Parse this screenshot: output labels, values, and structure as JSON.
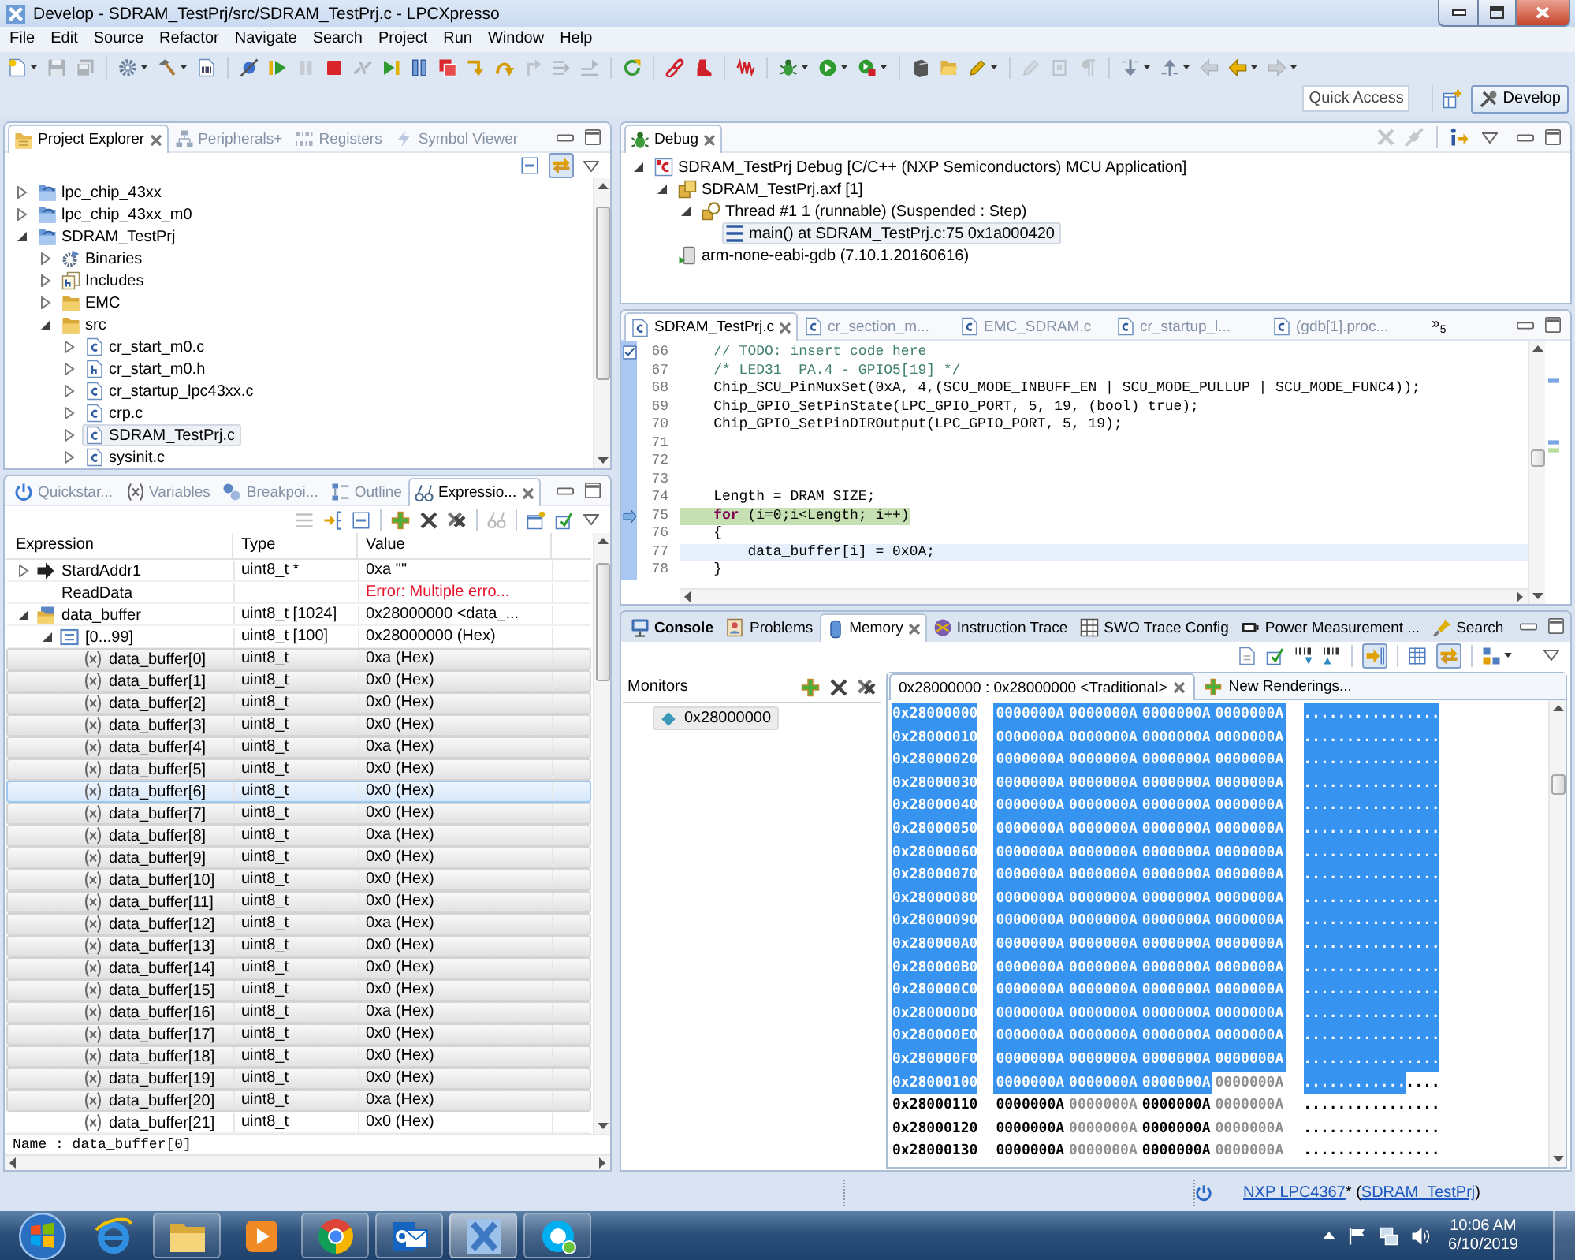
{
  "window": {
    "title": "Develop - SDRAM_TestPrj/src/SDRAM_TestPrj.c - LPCXpresso"
  },
  "menu": [
    "File",
    "Edit",
    "Source",
    "Refactor",
    "Navigate",
    "Search",
    "Project",
    "Run",
    "Window",
    "Help"
  ],
  "toolbar": [
    [
      {
        "disabled": false,
        "dropdown": true
      },
      {
        "disabled": true,
        "dropdown": false
      },
      {
        "disabled": true,
        "dropdown": false
      }
    ],
    [
      {
        "disabled": false,
        "dropdown": true
      },
      {
        "disabled": false,
        "dropdown": true
      },
      {
        "disabled": false,
        "dropdown": false
      }
    ],
    [
      {
        "disabled": false,
        "dropdown": false
      },
      {
        "disabled": false,
        "dropdown": false
      },
      {
        "disabled": true,
        "dropdown": false
      },
      {
        "disabled": false,
        "dropdown": false
      },
      {
        "disabled": true,
        "dropdown": false
      },
      {
        "disabled": false,
        "dropdown": false
      },
      {
        "disabled": false,
        "dropdown": false
      },
      {
        "disabled": false,
        "dropdown": false
      },
      {
        "disabled": false,
        "dropdown": false
      },
      {
        "disabled": false,
        "dropdown": false
      },
      {
        "disabled": true,
        "dropdown": false
      },
      {
        "disabled": true,
        "dropdown": false
      },
      {
        "disabled": true,
        "dropdown": false
      }
    ],
    [
      {
        "disabled": false,
        "dropdown": false
      }
    ],
    [
      {
        "disabled": false,
        "dropdown": false
      },
      {
        "disabled": false,
        "dropdown": false
      }
    ],
    [
      {
        "disabled": false,
        "dropdown": false
      }
    ],
    [
      {
        "disabled": false,
        "dropdown": true
      },
      {
        "disabled": false,
        "dropdown": true
      },
      {
        "disabled": false,
        "dropdown": true
      }
    ],
    [
      {
        "disabled": false,
        "dropdown": false
      },
      {
        "disabled": false,
        "dropdown": false
      },
      {
        "disabled": false,
        "dropdown": true
      }
    ],
    [
      {
        "disabled": true,
        "dropdown": false
      },
      {
        "disabled": true,
        "dropdown": false
      },
      {
        "disabled": true,
        "dropdown": false
      }
    ],
    [
      {
        "disabled": false,
        "dropdown": true
      },
      {
        "disabled": false,
        "dropdown": true
      },
      {
        "disabled": true,
        "dropdown": false
      },
      {
        "disabled": false,
        "dropdown": true
      },
      {
        "disabled": true,
        "dropdown": true
      }
    ]
  ],
  "quick_access": {
    "placeholder": "Quick Access"
  },
  "perspectives": [
    {
      "label": "Develop",
      "selected": true
    }
  ],
  "project_explorer": {
    "active": false,
    "tabs": [
      {
        "label": "Project Explorer",
        "selected": true
      },
      {
        "label": "Peripherals+",
        "selected": false
      },
      {
        "label": "Registers",
        "selected": false
      },
      {
        "label": "Symbol Viewer",
        "selected": false
      }
    ],
    "toolbar": [
      [
        {
          "pressed": false
        },
        {
          "pressed": true
        }
      ]
    ],
    "tree": [
      {
        "label": "lpc_chip_43xx",
        "kind": "project",
        "expanded": false,
        "selected": false
      },
      {
        "label": "lpc_chip_43xx_m0",
        "kind": "project",
        "expanded": false,
        "selected": false
      },
      {
        "label": "SDRAM_TestPrj",
        "kind": "project",
        "expanded": true,
        "selected": false,
        "children": [
          {
            "label": "Binaries",
            "kind": "binaries",
            "expanded": false,
            "selected": false
          },
          {
            "label": "Includes",
            "kind": "includes",
            "expanded": false,
            "selected": false
          },
          {
            "label": "EMC",
            "kind": "folder",
            "expanded": false,
            "selected": false
          },
          {
            "label": "src",
            "kind": "folder",
            "expanded": true,
            "selected": false,
            "children": [
              {
                "label": "cr_start_m0.c",
                "kind": "c-file",
                "expanded": false,
                "selected": false
              },
              {
                "label": "cr_start_m0.h",
                "kind": "h-file",
                "expanded": false,
                "selected": false
              },
              {
                "label": "cr_startup_lpc43xx.c",
                "kind": "c-file",
                "expanded": false,
                "selected": false
              },
              {
                "label": "crp.c",
                "kind": "c-file",
                "expanded": false,
                "selected": false
              },
              {
                "label": "SDRAM_TestPrj.c",
                "kind": "c-file",
                "expanded": false,
                "selected": true
              },
              {
                "label": "sysinit.c",
                "kind": "c-file",
                "expanded": false,
                "selected": false
              }
            ]
          }
        ]
      }
    ]
  },
  "debug": {
    "active": false,
    "tabs": [
      {
        "label": "Debug",
        "selected": true
      }
    ],
    "toolbar": [
      [
        {
          "disabled": true
        },
        {
          "disabled": true
        }
      ],
      [
        {
          "disabled": false
        }
      ]
    ],
    "tree": [
      {
        "label": "SDRAM_TestPrj Debug [C/C++ (NXP Semiconductors) MCU Application]",
        "kind": "launch",
        "expanded": true,
        "selected": false,
        "children": [
          {
            "label": "SDRAM_TestPrj.axf [1]",
            "kind": "process",
            "expanded": true,
            "selected": false,
            "children": [
              {
                "label": "Thread #1 1 (runnable) (Suspended : Step)",
                "kind": "thread",
                "expanded": true,
                "selected": false,
                "children": [
                  {
                    "label": "main() at SDRAM_TestPrj.c:75 0x1a000420",
                    "kind": "frame",
                    "selected": true
                  }
                ]
              }
            ]
          },
          {
            "label": "arm-none-eabi-gdb (7.10.1.20160616)",
            "kind": "debugger",
            "selected": false
          }
        ]
      }
    ]
  },
  "editor": {
    "active": false,
    "tabs": [
      {
        "label": "SDRAM_TestPrj.c",
        "selected": true
      },
      {
        "label": "cr_section_m...",
        "selected": false
      },
      {
        "label": "EMC_SDRAM.c",
        "selected": false
      },
      {
        "label": "cr_startup_l...",
        "selected": false
      },
      {
        "label": "(gdb[1].proc...",
        "selected": false
      }
    ],
    "overflow": "»$_{5}$",
    "lines": [
      {
        "number": "66",
        "kind": "task",
        "tokens": [
          {
            "kind": "comment",
            "text": "    // TODO: insert code here"
          }
        ]
      },
      {
        "number": "67",
        "kind": "plain",
        "tokens": [
          {
            "kind": "comment",
            "text": "    /* LED31  PA.4 - GPIO5[19] */"
          }
        ]
      },
      {
        "number": "68",
        "kind": "plain",
        "tokens": [
          {
            "kind": "plain",
            "text": "    Chip_SCU_PinMuxSet(0xA, 4,(SCU_MODE_INBUFF_EN | SCU_MODE_PULLUP | SCU_MODE_FUNC4));"
          }
        ]
      },
      {
        "number": "69",
        "kind": "plain",
        "tokens": [
          {
            "kind": "plain",
            "text": "    Chip_GPIO_SetPinState(LPC_GPIO_PORT, 5, 19, (bool) true);"
          }
        ]
      },
      {
        "number": "70",
        "kind": "plain",
        "tokens": [
          {
            "kind": "plain",
            "text": "    Chip_GPIO_SetPinDIROutput(LPC_GPIO_PORT, 5, 19);"
          }
        ]
      },
      {
        "number": "71",
        "kind": "plain"
      },
      {
        "number": "72",
        "kind": "plain"
      },
      {
        "number": "73",
        "kind": "plain"
      },
      {
        "number": "74",
        "kind": "plain",
        "tokens": [
          {
            "kind": "plain",
            "text": "    Length = DRAM_SIZE;"
          }
        ]
      },
      {
        "number": "75",
        "kind": "execution",
        "tokens": [
          {
            "kind": "keyword",
            "text": "    for"
          },
          {
            "kind": "plain",
            "text": " (i=0;i<Length; i++)"
          }
        ]
      },
      {
        "number": "76",
        "kind": "plain",
        "tokens": [
          {
            "kind": "plain",
            "text": "    {"
          }
        ]
      },
      {
        "number": "77",
        "kind": "cursor",
        "tokens": [
          {
            "kind": "plain",
            "text": "        data_buffer[i] = 0x0A;"
          }
        ]
      },
      {
        "number": "78",
        "kind": "plain",
        "tokens": [
          {
            "kind": "plain",
            "text": "    }"
          }
        ]
      }
    ]
  },
  "expressions": {
    "active": false,
    "tabs": [
      {
        "label": "Quickstar...",
        "selected": false
      },
      {
        "label": "Variables",
        "selected": false
      },
      {
        "label": "Breakpoi...",
        "selected": false
      },
      {
        "label": "Outline",
        "selected": false
      },
      {
        "label": "Expressio...",
        "selected": true
      }
    ],
    "toolbar": [
      [
        {
          "disabled": true
        },
        {
          "disabled": false
        },
        {
          "disabled": false
        }
      ],
      [
        {
          "disabled": false
        },
        {
          "disabled": false
        },
        {
          "disabled": false
        }
      ],
      [
        {
          "disabled": true
        }
      ],
      [
        {
          "disabled": false
        },
        {
          "disabled": false
        }
      ]
    ],
    "columns": [
      "Expression",
      "Type",
      "Value"
    ],
    "rows": [
      {
        "expression": "StardAddr1",
        "type": "uint8_t *",
        "value": "0xa \"\"",
        "kind": "pointer",
        "expanded": false,
        "selected": false,
        "hovered": false
      },
      {
        "expression": "ReadData",
        "value": "Error: Multiple erro...",
        "kind": "error",
        "selected": false,
        "hovered": false
      },
      {
        "expression": "data_buffer",
        "type": "uint8_t [1024]",
        "value": "0x28000000 <data_...",
        "kind": "array",
        "expanded": true,
        "selected": false,
        "hovered": false,
        "children": [
          {
            "expression": "[0...99]",
            "type": "uint8_t [100]",
            "value": "0x28000000 (Hex)",
            "kind": "range",
            "expanded": true,
            "selected": false,
            "hovered": false,
            "children": [
              {
                "expression": "data_buffer[0]",
                "type": "uint8_t",
                "value": "0xa (Hex)",
                "kind": "element",
                "selected": true,
                "hovered": false
              },
              {
                "expression": "data_buffer[1]",
                "type": "uint8_t",
                "value": "0x0 (Hex)",
                "kind": "element",
                "selected": true,
                "hovered": false
              },
              {
                "expression": "data_buffer[2]",
                "type": "uint8_t",
                "value": "0x0 (Hex)",
                "kind": "element",
                "selected": true,
                "hovered": false
              },
              {
                "expression": "data_buffer[3]",
                "type": "uint8_t",
                "value": "0x0 (Hex)",
                "kind": "element",
                "selected": true,
                "hovered": false
              },
              {
                "expression": "data_buffer[4]",
                "type": "uint8_t",
                "value": "0xa (Hex)",
                "kind": "element",
                "selected": true,
                "hovered": false
              },
              {
                "expression": "data_buffer[5]",
                "type": "uint8_t",
                "value": "0x0 (Hex)",
                "kind": "element",
                "selected": true,
                "hovered": false
              },
              {
                "expression": "data_buffer[6]",
                "type": "uint8_t",
                "value": "0x0 (Hex)",
                "kind": "element",
                "selected": true,
                "hovered": true
              },
              {
                "expression": "data_buffer[7]",
                "type": "uint8_t",
                "value": "0x0 (Hex)",
                "kind": "element",
                "selected": true,
                "hovered": false
              },
              {
                "expression": "data_buffer[8]",
                "type": "uint8_t",
                "value": "0xa (Hex)",
                "kind": "element",
                "selected": true,
                "hovered": false
              },
              {
                "expression": "data_buffer[9]",
                "type": "uint8_t",
                "value": "0x0 (Hex)",
                "kind": "element",
                "selected": true,
                "hovered": false
              },
              {
                "expression": "data_buffer[10]",
                "type": "uint8_t",
                "value": "0x0 (Hex)",
                "kind": "element",
                "selected": true,
                "hovered": false
              },
              {
                "expression": "data_buffer[11]",
                "type": "uint8_t",
                "value": "0x0 (Hex)",
                "kind": "element",
                "selected": true,
                "hovered": false
              },
              {
                "expression": "data_buffer[12]",
                "type": "uint8_t",
                "value": "0xa (Hex)",
                "kind": "element",
                "selected": true,
                "hovered": false
              },
              {
                "expression": "data_buffer[13]",
                "type": "uint8_t",
                "value": "0x0 (Hex)",
                "kind": "element",
                "selected": true,
                "hovered": false
              },
              {
                "expression": "data_buffer[14]",
                "type": "uint8_t",
                "value": "0x0 (Hex)",
                "kind": "element",
                "selected": true,
                "hovered": false
              },
              {
                "expression": "data_buffer[15]",
                "type": "uint8_t",
                "value": "0x0 (Hex)",
                "kind": "element",
                "selected": true,
                "hovered": false
              },
              {
                "expression": "data_buffer[16]",
                "type": "uint8_t",
                "value": "0xa (Hex)",
                "kind": "element",
                "selected": true,
                "hovered": false
              },
              {
                "expression": "data_buffer[17]",
                "type": "uint8_t",
                "value": "0x0 (Hex)",
                "kind": "element",
                "selected": true,
                "hovered": false
              },
              {
                "expression": "data_buffer[18]",
                "type": "uint8_t",
                "value": "0x0 (Hex)",
                "kind": "element",
                "selected": true,
                "hovered": false
              },
              {
                "expression": "data_buffer[19]",
                "type": "uint8_t",
                "value": "0x0 (Hex)",
                "kind": "element",
                "selected": true,
                "hovered": false
              },
              {
                "expression": "data_buffer[20]",
                "type": "uint8_t",
                "value": "0xa (Hex)",
                "kind": "element",
                "selected": true,
                "hovered": false
              },
              {
                "expression": "data_buffer[21]",
                "type": "uint8_t",
                "value": "0x0 (Hex)",
                "kind": "element",
                "selected": false,
                "hovered": false
              }
            ]
          }
        ]
      }
    ],
    "detail": "Name : data_buffer[0]"
  },
  "memory": {
    "active": true,
    "tabs": [
      {
        "label": "Console",
        "selected": false,
        "changed": true
      },
      {
        "label": "Problems",
        "selected": false,
        "changed": false
      },
      {
        "label": "Memory",
        "selected": true,
        "changed": false
      },
      {
        "label": "Instruction Trace",
        "selected": false,
        "changed": false
      },
      {
        "label": "SWO Trace Config",
        "selected": false,
        "changed": false
      },
      {
        "label": "Power Measurement ...",
        "selected": false,
        "changed": false
      },
      {
        "label": "Search",
        "selected": false,
        "changed": false
      }
    ],
    "toolbar": [
      [
        {
          "pressed": false,
          "dropdown": false
        },
        {
          "pressed": false,
          "dropdown": false
        },
        {
          "pressed": false,
          "dropdown": false
        },
        {
          "pressed": false,
          "dropdown": false
        }
      ],
      [
        {
          "pressed": true,
          "dropdown": false
        }
      ],
      [
        {
          "pressed": false,
          "dropdown": false
        },
        {
          "pressed": true,
          "dropdown": false
        }
      ],
      [
        {
          "pressed": false,
          "dropdown": true
        }
      ]
    ],
    "monitors": {
      "title": "Monitors",
      "items": [
        {
          "label": "0x28000000",
          "selected": true
        }
      ]
    },
    "renderings": [
      {
        "label": "0x28000000 : 0x28000000 <Traditional>",
        "selected": true
      },
      {
        "label": "New Renderings...",
        "selected": false
      }
    ],
    "rows": [
      {
        "address": {
          "text": "0x28000000",
          "selected": true
        },
        "words": [
          {
            "text": "0000000A",
            "selected": true
          },
          {
            "text": "0000000A",
            "selected": true
          },
          {
            "text": "0000000A",
            "selected": true
          },
          {
            "text": "0000000A",
            "selected": true
          }
        ],
        "ascii": [
          {
            "text": "................",
            "selected": true
          }
        ]
      },
      {
        "address": {
          "text": "0x28000010",
          "selected": true
        },
        "words": [
          {
            "text": "0000000A",
            "selected": true
          },
          {
            "text": "0000000A",
            "selected": true
          },
          {
            "text": "0000000A",
            "selected": true
          },
          {
            "text": "0000000A",
            "selected": true
          }
        ],
        "ascii": [
          {
            "text": "................",
            "selected": true
          }
        ]
      },
      {
        "address": {
          "text": "0x28000020",
          "selected": true
        },
        "words": [
          {
            "text": "0000000A",
            "selected": true
          },
          {
            "text": "0000000A",
            "selected": true
          },
          {
            "text": "0000000A",
            "selected": true
          },
          {
            "text": "0000000A",
            "selected": true
          }
        ],
        "ascii": [
          {
            "text": "................",
            "selected": true
          }
        ]
      },
      {
        "address": {
          "text": "0x28000030",
          "selected": true
        },
        "words": [
          {
            "text": "0000000A",
            "selected": true
          },
          {
            "text": "0000000A",
            "selected": true
          },
          {
            "text": "0000000A",
            "selected": true
          },
          {
            "text": "0000000A",
            "selected": true
          }
        ],
        "ascii": [
          {
            "text": "................",
            "selected": true
          }
        ]
      },
      {
        "address": {
          "text": "0x28000040",
          "selected": true
        },
        "words": [
          {
            "text": "0000000A",
            "selected": true
          },
          {
            "text": "0000000A",
            "selected": true
          },
          {
            "text": "0000000A",
            "selected": true
          },
          {
            "text": "0000000A",
            "selected": true
          }
        ],
        "ascii": [
          {
            "text": "................",
            "selected": true
          }
        ]
      },
      {
        "address": {
          "text": "0x28000050",
          "selected": true
        },
        "words": [
          {
            "text": "0000000A",
            "selected": true
          },
          {
            "text": "0000000A",
            "selected": true
          },
          {
            "text": "0000000A",
            "selected": true
          },
          {
            "text": "0000000A",
            "selected": true
          }
        ],
        "ascii": [
          {
            "text": "................",
            "selected": true
          }
        ]
      },
      {
        "address": {
          "text": "0x28000060",
          "selected": true
        },
        "words": [
          {
            "text": "0000000A",
            "selected": true
          },
          {
            "text": "0000000A",
            "selected": true
          },
          {
            "text": "0000000A",
            "selected": true
          },
          {
            "text": "0000000A",
            "selected": true
          }
        ],
        "ascii": [
          {
            "text": "................",
            "selected": true
          }
        ]
      },
      {
        "address": {
          "text": "0x28000070",
          "selected": true
        },
        "words": [
          {
            "text": "0000000A",
            "selected": true
          },
          {
            "text": "0000000A",
            "selected": true
          },
          {
            "text": "0000000A",
            "selected": true
          },
          {
            "text": "0000000A",
            "selected": true
          }
        ],
        "ascii": [
          {
            "text": "................",
            "selected": true
          }
        ]
      },
      {
        "address": {
          "text": "0x28000080",
          "selected": true
        },
        "words": [
          {
            "text": "0000000A",
            "selected": true
          },
          {
            "text": "0000000A",
            "selected": true
          },
          {
            "text": "0000000A",
            "selected": true
          },
          {
            "text": "0000000A",
            "selected": true
          }
        ],
        "ascii": [
          {
            "text": "................",
            "selected": true
          }
        ]
      },
      {
        "address": {
          "text": "0x28000090",
          "selected": true
        },
        "words": [
          {
            "text": "0000000A",
            "selected": true
          },
          {
            "text": "0000000A",
            "selected": true
          },
          {
            "text": "0000000A",
            "selected": true
          },
          {
            "text": "0000000A",
            "selected": true
          }
        ],
        "ascii": [
          {
            "text": "................",
            "selected": true
          }
        ]
      },
      {
        "address": {
          "text": "0x280000A0",
          "selected": true
        },
        "words": [
          {
            "text": "0000000A",
            "selected": true
          },
          {
            "text": "0000000A",
            "selected": true
          },
          {
            "text": "0000000A",
            "selected": true
          },
          {
            "text": "0000000A",
            "selected": true
          }
        ],
        "ascii": [
          {
            "text": "................",
            "selected": true
          }
        ]
      },
      {
        "address": {
          "text": "0x280000B0",
          "selected": true
        },
        "words": [
          {
            "text": "0000000A",
            "selected": true
          },
          {
            "text": "0000000A",
            "selected": true
          },
          {
            "text": "0000000A",
            "selected": true
          },
          {
            "text": "0000000A",
            "selected": true
          }
        ],
        "ascii": [
          {
            "text": "................",
            "selected": true
          }
        ]
      },
      {
        "address": {
          "text": "0x280000C0",
          "selected": true
        },
        "words": [
          {
            "text": "0000000A",
            "selected": true
          },
          {
            "text": "0000000A",
            "selected": true
          },
          {
            "text": "0000000A",
            "selected": true
          },
          {
            "text": "0000000A",
            "selected": true
          }
        ],
        "ascii": [
          {
            "text": "................",
            "selected": true
          }
        ]
      },
      {
        "address": {
          "text": "0x280000D0",
          "selected": true
        },
        "words": [
          {
            "text": "0000000A",
            "selected": true
          },
          {
            "text": "0000000A",
            "selected": true
          },
          {
            "text": "0000000A",
            "selected": true
          },
          {
            "text": "0000000A",
            "selected": true
          }
        ],
        "ascii": [
          {
            "text": "................",
            "selected": true
          }
        ]
      },
      {
        "address": {
          "text": "0x280000E0",
          "selected": true
        },
        "words": [
          {
            "text": "0000000A",
            "selected": true
          },
          {
            "text": "0000000A",
            "selected": true
          },
          {
            "text": "0000000A",
            "selected": true
          },
          {
            "text": "0000000A",
            "selected": true
          }
        ],
        "ascii": [
          {
            "text": "................",
            "selected": true
          }
        ]
      },
      {
        "address": {
          "text": "0x280000F0",
          "selected": true
        },
        "words": [
          {
            "text": "0000000A",
            "selected": true
          },
          {
            "text": "0000000A",
            "selected": true
          },
          {
            "text": "0000000A",
            "selected": true
          },
          {
            "text": "0000000A",
            "selected": true
          }
        ],
        "ascii": [
          {
            "text": "................",
            "selected": true
          }
        ]
      },
      {
        "address": {
          "text": "0x28000100",
          "selected": true
        },
        "words": [
          {
            "text": "0000000A",
            "selected": true
          },
          {
            "text": "0000000A",
            "selected": true
          },
          {
            "text": "0000000A",
            "selected": true
          },
          {
            "text": "0000000A",
            "selected": false
          }
        ],
        "ascii": [
          {
            "text": "............",
            "selected": true
          },
          {
            "text": "....",
            "selected": false
          }
        ]
      },
      {
        "address": {
          "text": "0x28000110",
          "selected": false
        },
        "words": [
          {
            "text": "0000000A",
            "selected": false
          },
          {
            "text": "0000000A",
            "selected": false
          },
          {
            "text": "0000000A",
            "selected": false
          },
          {
            "text": "0000000A",
            "selected": false
          }
        ],
        "ascii": [
          {
            "text": "................",
            "selected": false
          }
        ]
      },
      {
        "address": {
          "text": "0x28000120",
          "selected": false
        },
        "words": [
          {
            "text": "0000000A",
            "selected": false
          },
          {
            "text": "0000000A",
            "selected": false
          },
          {
            "text": "0000000A",
            "selected": false
          },
          {
            "text": "0000000A",
            "selected": false
          }
        ],
        "ascii": [
          {
            "text": "................",
            "selected": false
          }
        ]
      },
      {
        "address": {
          "text": "0x28000130",
          "selected": false
        },
        "words": [
          {
            "text": "0000000A",
            "selected": false
          },
          {
            "text": "0000000A",
            "selected": false
          },
          {
            "text": "0000000A",
            "selected": false
          },
          {
            "text": "0000000A",
            "selected": false
          }
        ],
        "ascii": [
          {
            "text": "................",
            "selected": false
          }
        ]
      }
    ]
  },
  "status_bar": {
    "parts": [
      {
        "kind": "link",
        "text": "NXP LPC4367"
      },
      {
        "kind": "text",
        "text": "* ("
      },
      {
        "kind": "link",
        "text": "SDRAM_TestPrj"
      },
      {
        "kind": "text",
        "text": ")"
      }
    ]
  },
  "taskbar": {
    "apps": [
      {
        "running": false,
        "selected": false
      },
      {
        "running": true,
        "selected": false
      },
      {
        "running": false,
        "selected": false
      },
      {
        "running": true,
        "selected": false
      },
      {
        "running": true,
        "selected": false
      },
      {
        "running": true,
        "selected": true
      },
      {
        "running": true,
        "selected": false
      }
    ],
    "clock": {
      "time": "10:06 AM",
      "date": "6/10/2019"
    }
  }
}
